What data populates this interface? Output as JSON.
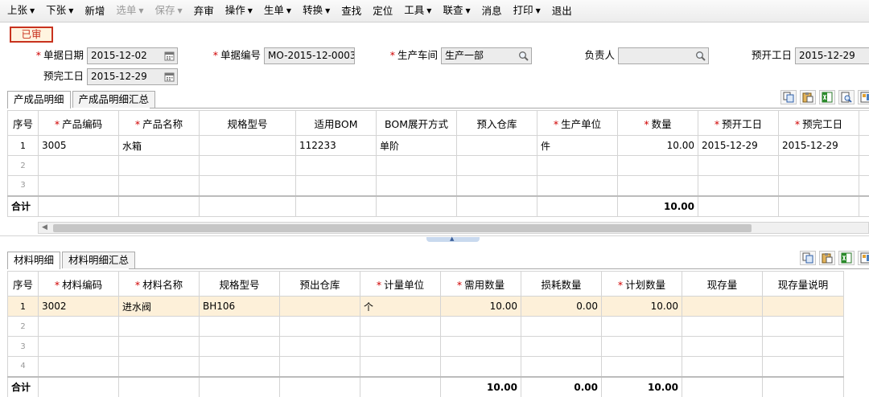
{
  "toolbar": {
    "items": [
      {
        "label": "上张",
        "caret": true,
        "disabled": false
      },
      {
        "label": "下张",
        "caret": true,
        "disabled": false
      },
      {
        "label": "新增",
        "caret": false,
        "disabled": false
      },
      {
        "label": "选单",
        "caret": true,
        "disabled": true
      },
      {
        "label": "保存",
        "caret": true,
        "disabled": true
      },
      {
        "label": "弃审",
        "caret": false,
        "disabled": false
      },
      {
        "label": "操作",
        "caret": true,
        "disabled": false
      },
      {
        "label": "生单",
        "caret": true,
        "disabled": false
      },
      {
        "label": "转换",
        "caret": true,
        "disabled": false
      },
      {
        "label": "查找",
        "caret": false,
        "disabled": false
      },
      {
        "label": "定位",
        "caret": false,
        "disabled": false
      },
      {
        "label": "工具",
        "caret": true,
        "disabled": false
      },
      {
        "label": "联查",
        "caret": true,
        "disabled": false
      },
      {
        "label": "消息",
        "caret": false,
        "disabled": false
      },
      {
        "label": "打印",
        "caret": true,
        "disabled": false
      },
      {
        "label": "退出",
        "caret": false,
        "disabled": false
      }
    ]
  },
  "status": {
    "label": "已审"
  },
  "form": {
    "doc_date": {
      "label": "单据日期",
      "value": "2015-12-02"
    },
    "doc_no": {
      "label": "单据编号",
      "value": "MO-2015-12-0003"
    },
    "workshop": {
      "label": "生产车间",
      "value": "生产一部"
    },
    "owner": {
      "label": "负责人",
      "value": ""
    },
    "plan_start": {
      "label": "预开工日",
      "value": "2015-12-29"
    },
    "plan_end": {
      "label": "预完工日",
      "value": "2015-12-29"
    }
  },
  "product": {
    "tabs": [
      "产成品明细",
      "产成品明细汇总"
    ],
    "columns": [
      "序号",
      "产品编码",
      "产品名称",
      "规格型号",
      "适用BOM",
      "BOM展开方式",
      "预入仓库",
      "生产单位",
      "数量",
      "预开工日",
      "预完工日"
    ],
    "rows": [
      [
        "1",
        "3005",
        "水箱",
        "",
        "112233",
        "单阶",
        "",
        "件",
        "10.00",
        "2015-12-29",
        "2015-12-29"
      ],
      [
        "2",
        "",
        "",
        "",
        "",
        "",
        "",
        "",
        "",
        "",
        ""
      ],
      [
        "3",
        "",
        "",
        "",
        "",
        "",
        "",
        "",
        "",
        "",
        ""
      ]
    ],
    "total_label": "合计",
    "total_qty": "10.00"
  },
  "material": {
    "tabs": [
      "材料明细",
      "材料明细汇总"
    ],
    "columns": [
      "序号",
      "材料编码",
      "材料名称",
      "规格型号",
      "预出仓库",
      "计量单位",
      "需用数量",
      "损耗数量",
      "计划数量",
      "现存量",
      "现存量说明"
    ],
    "rows": [
      [
        "1",
        "3002",
        "进水阀",
        "BH106",
        "",
        "个",
        "10.00",
        "0.00",
        "10.00",
        "",
        ""
      ],
      [
        "2",
        "",
        "",
        "",
        "",
        "",
        "",
        "",
        "",
        "",
        ""
      ],
      [
        "3",
        "",
        "",
        "",
        "",
        "",
        "",
        "",
        "",
        "",
        ""
      ],
      [
        "4",
        "",
        "",
        "",
        "",
        "",
        "",
        "",
        "",
        "",
        ""
      ]
    ],
    "total_label": "合计",
    "total_need": "10.00",
    "total_loss": "0.00",
    "total_plan": "10.00"
  }
}
